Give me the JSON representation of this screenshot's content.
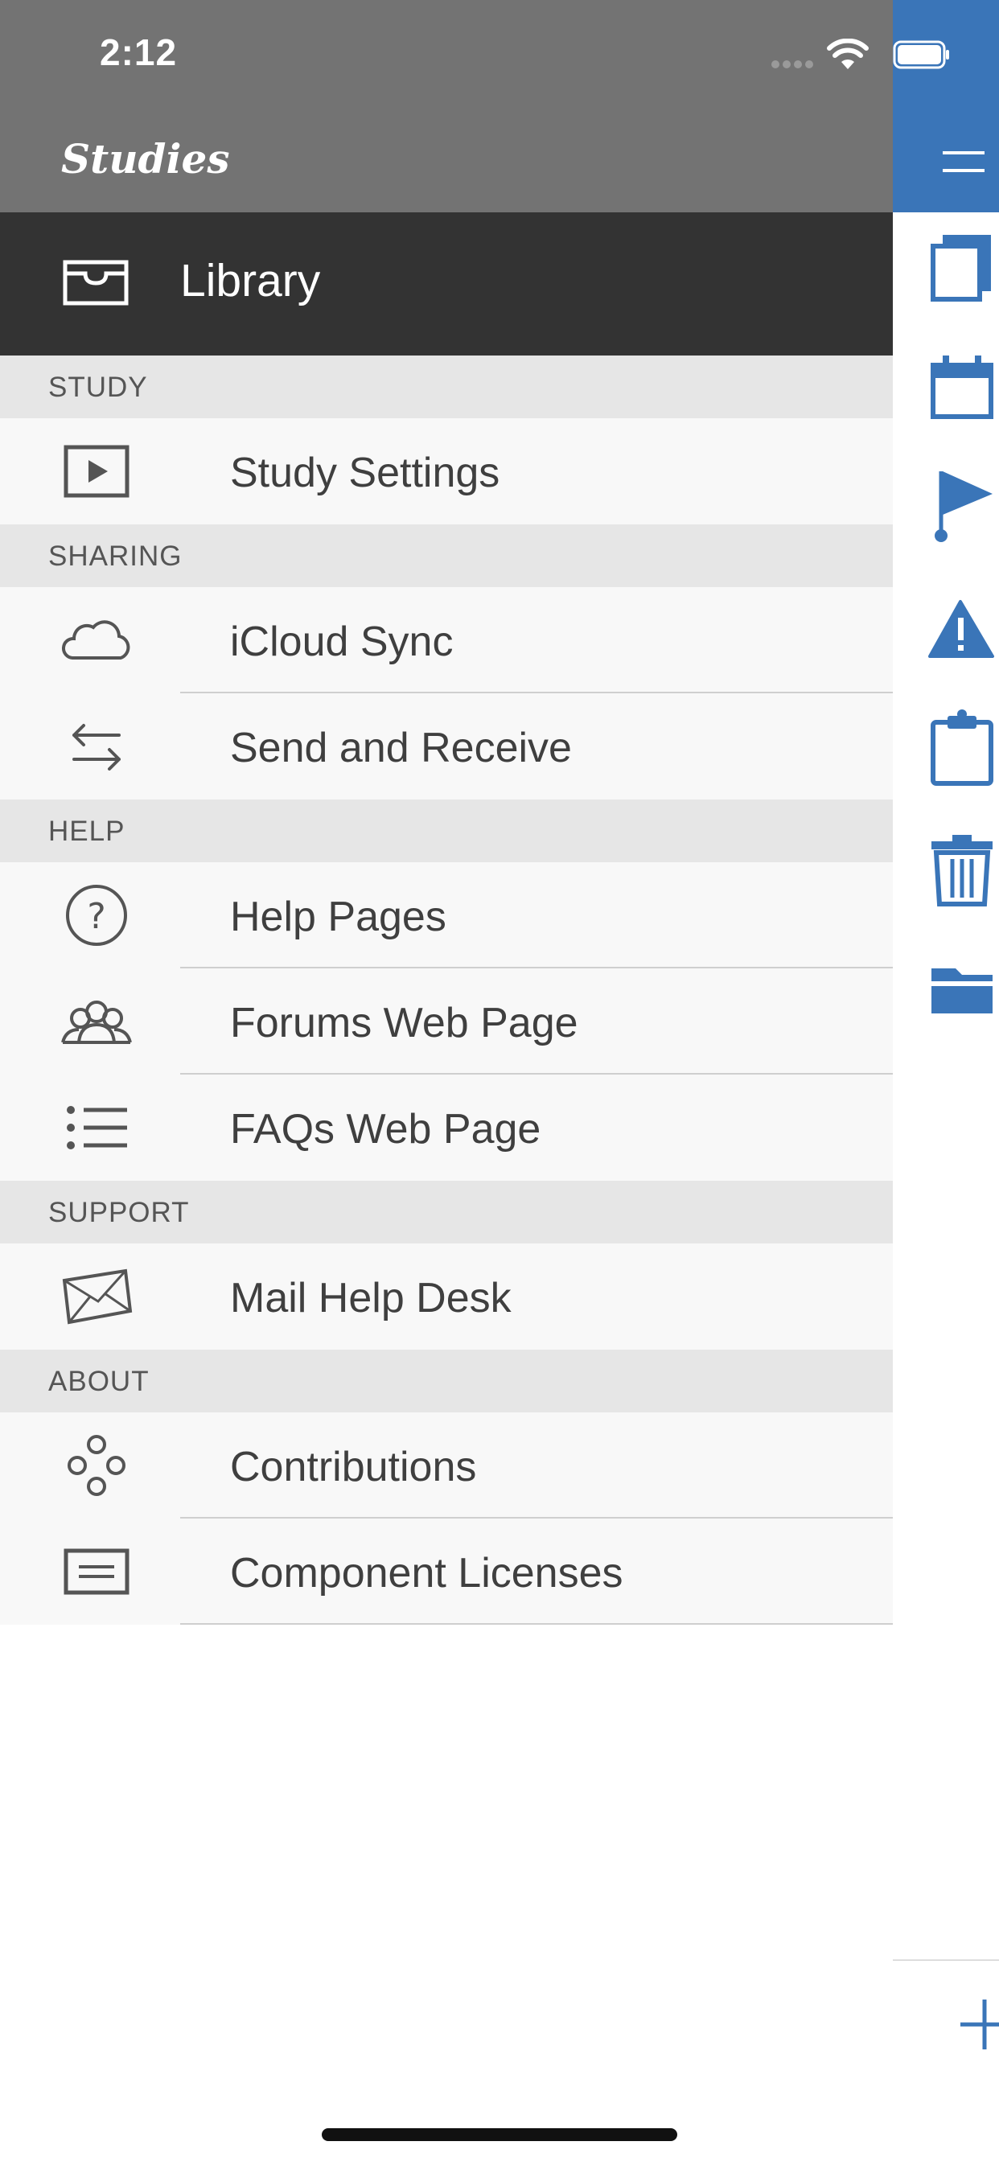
{
  "status_bar": {
    "time": "2:12"
  },
  "app": {
    "title": "Studies"
  },
  "library": {
    "label": "Library",
    "icon": "inbox-tray-icon"
  },
  "sections": {
    "study": "STUDY",
    "sharing": "SHARING",
    "help": "HELP",
    "support": "SUPPORT",
    "about": "ABOUT"
  },
  "items": {
    "study_settings": "Study Settings",
    "icloud_sync": "iCloud Sync",
    "send_receive": "Send and Receive",
    "help_pages": "Help Pages",
    "forums": "Forums Web Page",
    "faqs": "FAQs Web Page",
    "mail_help_desk": "Mail Help Desk",
    "contributions": "Contributions",
    "component_licenses": "Component Licenses"
  },
  "icons": {
    "study_settings": "play-box-icon",
    "icloud_sync": "cloud-icon",
    "send_receive": "swap-arrows-icon",
    "help_pages": "question-circle-icon",
    "forums": "people-group-icon",
    "faqs": "list-icon",
    "mail_help_desk": "envelope-icon",
    "contributions": "circles-icon",
    "component_licenses": "document-lines-icon"
  },
  "right_panel": {
    "icons": [
      "cards-icon",
      "calendar-icon",
      "flag-icon",
      "warning-icon",
      "clipboard-icon",
      "trash-icon",
      "folder-icon",
      "menu-icon",
      "add-icon"
    ]
  },
  "colors": {
    "header_gray": "#737373",
    "library_dark": "#333333",
    "section_bg": "#e6e6e6",
    "row_bg": "#f8f8f8",
    "accent_blue": "#3a75b8",
    "icon_gray": "#555555"
  }
}
